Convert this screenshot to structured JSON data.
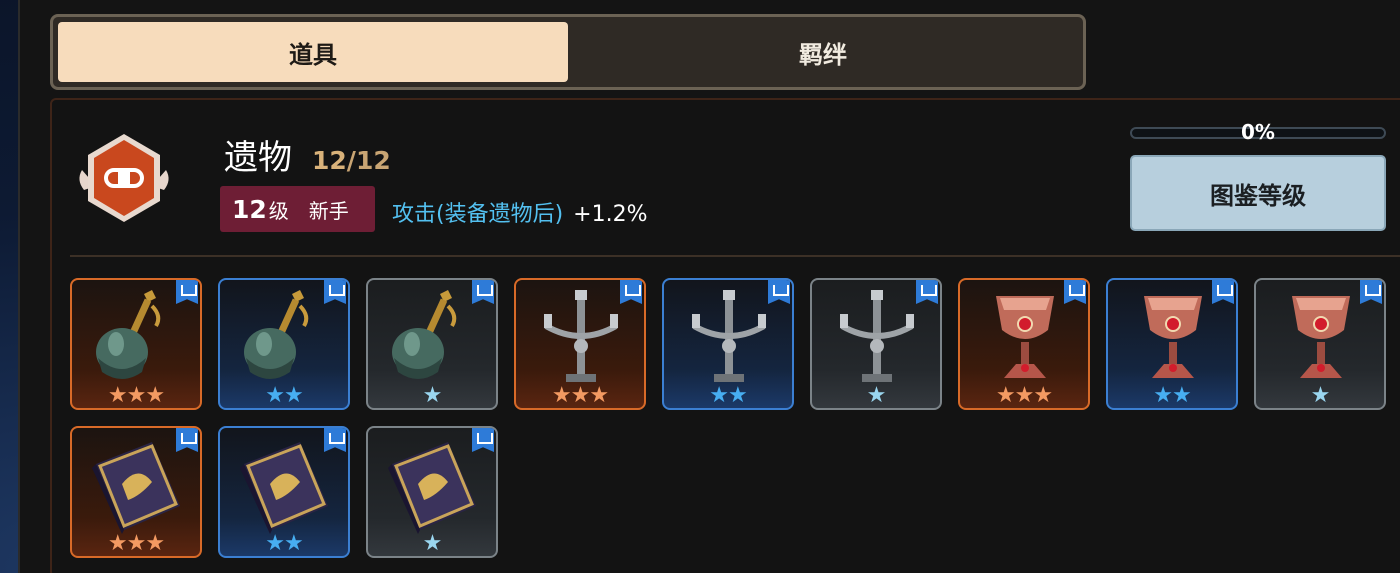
{
  "tabs": [
    {
      "label": "道具",
      "active": true
    },
    {
      "label": "羁绊",
      "active": false
    }
  ],
  "header": {
    "title": "遗物",
    "count_current": "12",
    "count_sep": "/",
    "count_max": "12",
    "level_num": "12",
    "level_unit": "级",
    "level_rank": "新手",
    "bonus_attr": "攻击(装备遗物后)",
    "bonus_value": "+1.2%",
    "progress_label": "0%",
    "progress_fraction": 0.0,
    "codex_button": "图鉴等级"
  },
  "colors": {
    "orange": "#d86a28",
    "blue": "#3b7fd2",
    "grey": "#7b8388",
    "badge": "#6e1e35",
    "accent_text": "#53c0f0"
  },
  "items": [
    {
      "icon": "bell-icon",
      "rarity": "orange",
      "stars": "★★★"
    },
    {
      "icon": "bell-icon",
      "rarity": "blue",
      "stars": "★★"
    },
    {
      "icon": "bell-icon",
      "rarity": "grey",
      "stars": "★"
    },
    {
      "icon": "candelabra-icon",
      "rarity": "orange",
      "stars": "★★★"
    },
    {
      "icon": "candelabra-icon",
      "rarity": "blue",
      "stars": "★★"
    },
    {
      "icon": "candelabra-icon",
      "rarity": "grey",
      "stars": "★"
    },
    {
      "icon": "chalice-icon",
      "rarity": "orange",
      "stars": "★★★"
    },
    {
      "icon": "chalice-icon",
      "rarity": "blue",
      "stars": "★★"
    },
    {
      "icon": "chalice-icon",
      "rarity": "grey",
      "stars": "★"
    },
    {
      "icon": "tome-icon",
      "rarity": "orange",
      "stars": "★★★"
    },
    {
      "icon": "tome-icon",
      "rarity": "blue",
      "stars": "★★"
    },
    {
      "icon": "tome-icon",
      "rarity": "grey",
      "stars": "★"
    }
  ]
}
